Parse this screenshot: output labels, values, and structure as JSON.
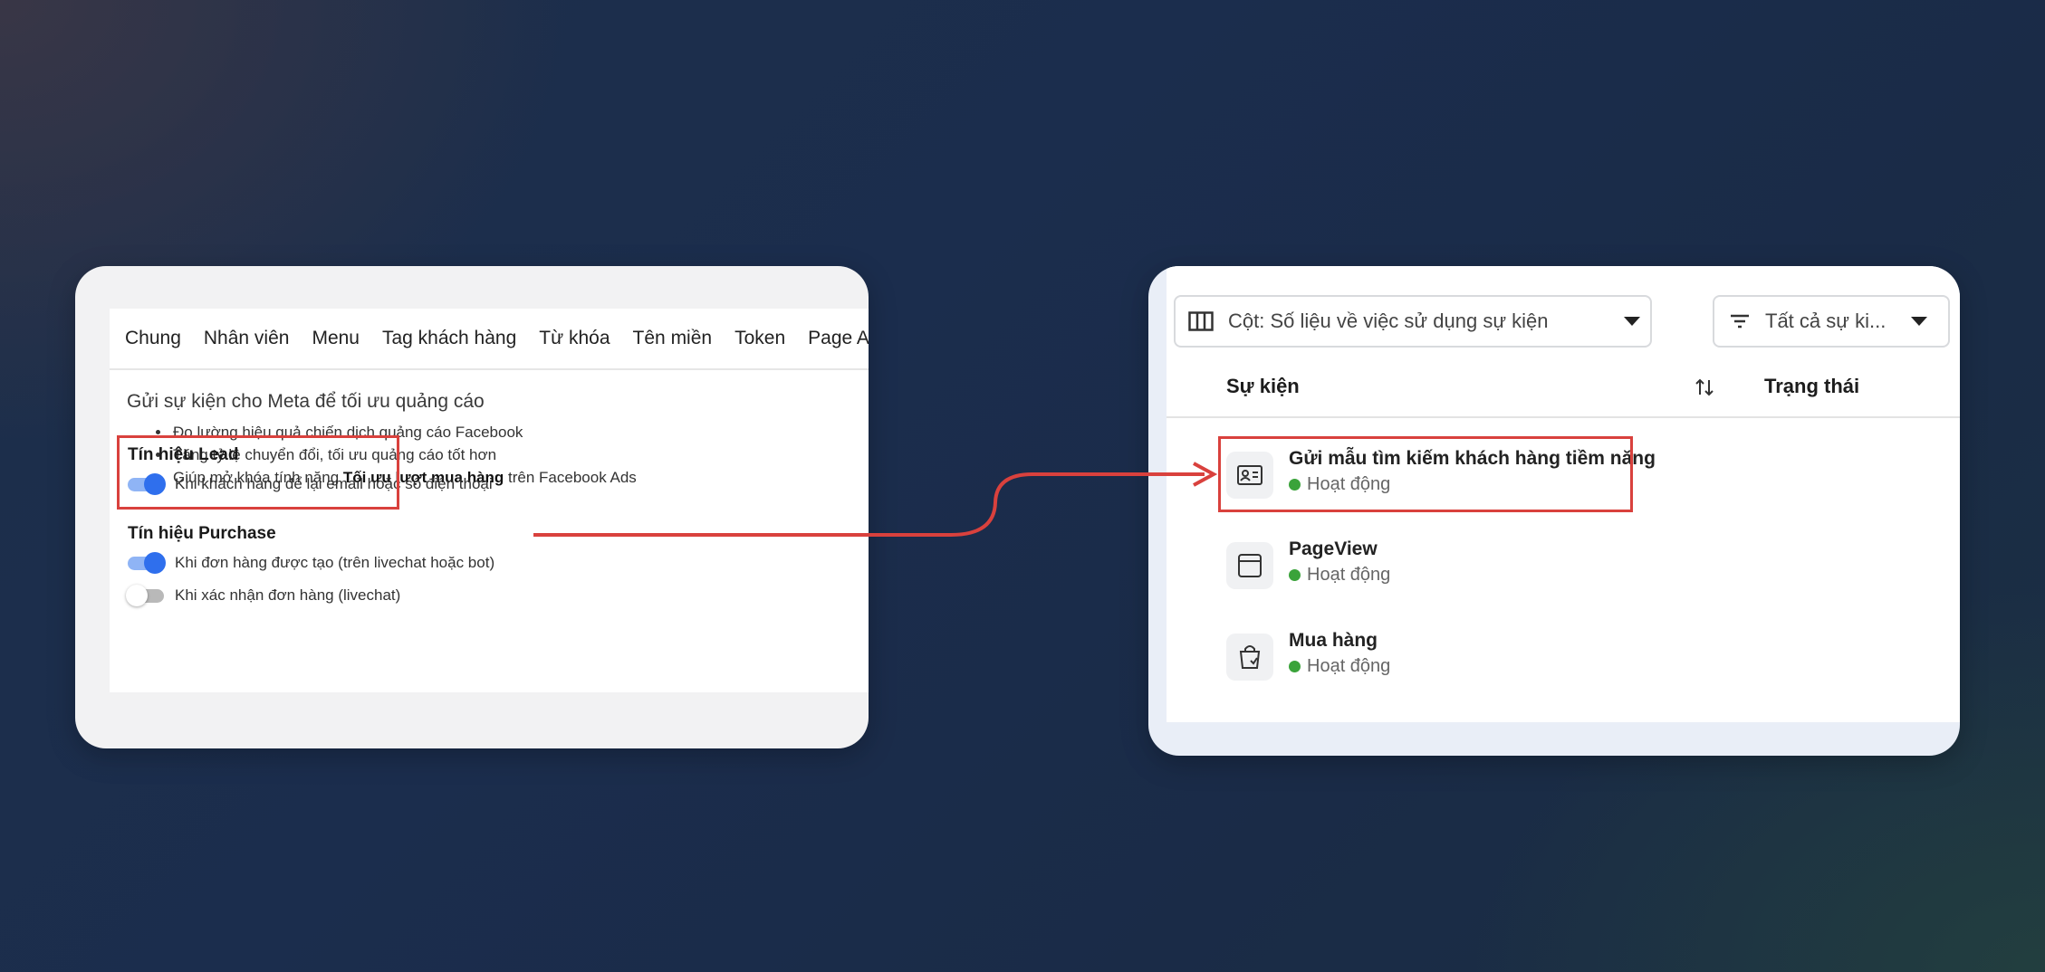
{
  "left_panel": {
    "tabs": [
      "Chung",
      "Nhân viên",
      "Menu",
      "Tag khách hàng",
      "Từ khóa",
      "Tên miền",
      "Token",
      "Page Attribu"
    ],
    "description_title": "Gửi sự kiện cho Meta để tối ưu quảng cáo",
    "bullets": [
      {
        "text": "Đo lường hiệu quả chiến dịch quảng cáo Facebook"
      },
      {
        "text": "Tăng tỷ lệ chuyển đổi, tối ưu quảng cáo tốt hơn"
      },
      {
        "prefix": "Giúp mở khóa tính năng ",
        "bold": "Tối ưu lượt mua hàng",
        "suffix": " trên Facebook Ads"
      }
    ],
    "lead_section": {
      "title": "Tín hiệu Lead",
      "toggles": [
        {
          "label": "Khi khách hàng để lại email hoặc số điện thoại",
          "on": true
        }
      ]
    },
    "purchase_section": {
      "title": "Tín hiệu Purchase",
      "toggles": [
        {
          "label": "Khi đơn hàng được tạo (trên livechat hoặc bot)",
          "on": true
        },
        {
          "label": "Khi xác nhận đơn hàng (livechat)",
          "on": false
        }
      ]
    }
  },
  "right_panel": {
    "columns_dropdown": {
      "label": "Cột: Số liệu về việc sử dụng sự kiện",
      "icon": "columns-icon"
    },
    "filter_dropdown": {
      "label": "Tất cả sự ki...",
      "icon": "filter-icon"
    },
    "table_headers": {
      "event": "Sự kiện",
      "status": "Trạng thái"
    },
    "events": [
      {
        "name": "Gửi mẫu tìm kiếm khách hàng tiềm năng",
        "status": "Hoạt động",
        "icon": "contact-card-icon",
        "highlighted": true
      },
      {
        "name": "PageView",
        "status": "Hoạt động",
        "icon": "browser-window-icon",
        "highlighted": false
      },
      {
        "name": "Mua hàng",
        "status": "Hoạt động",
        "icon": "shopping-bag-icon",
        "highlighted": false
      }
    ]
  },
  "colors": {
    "highlight": "#d9413d",
    "toggle_on": "#2f6fed",
    "status_active": "#3aa33a",
    "background": "#1b2d4d"
  }
}
